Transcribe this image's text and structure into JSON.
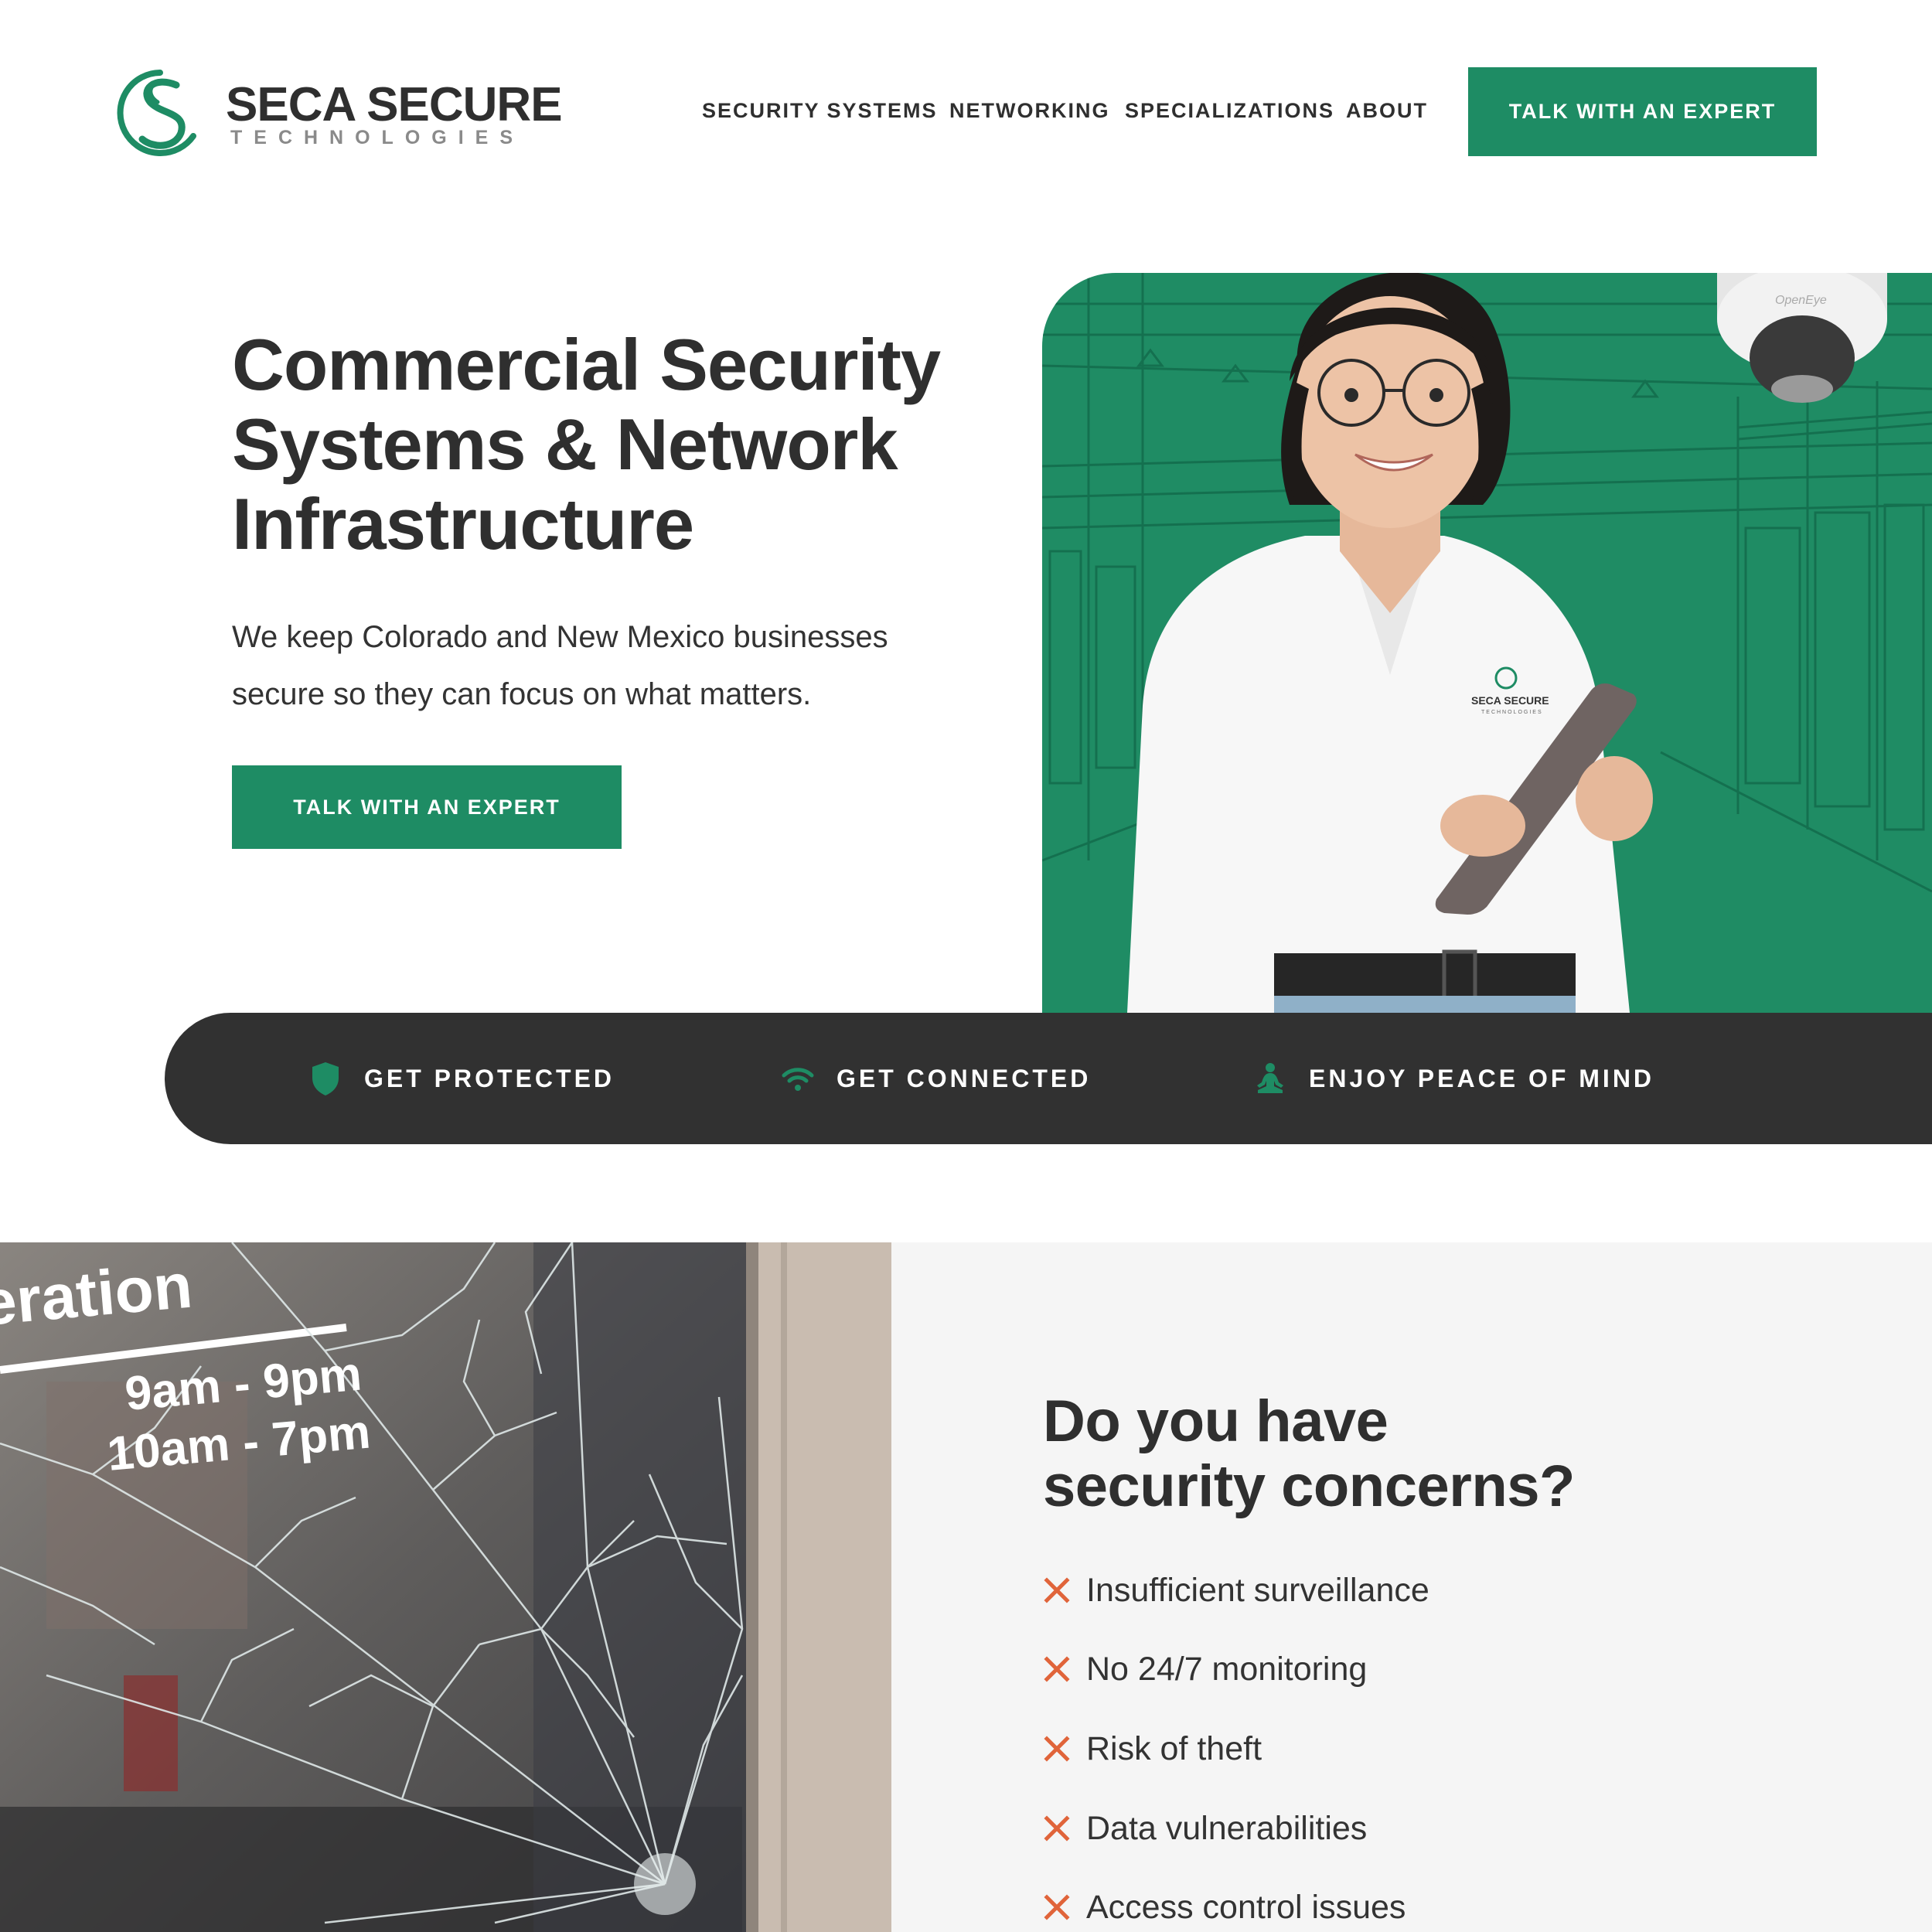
{
  "brand": {
    "name": "SECA SECURE",
    "tagline": "TECHNOLOGIES",
    "accent_color": "#1e8c64",
    "dark_color": "#313131",
    "concern_marker_color": "#e0643a"
  },
  "nav": {
    "items": [
      {
        "label": "SECURITY SYSTEMS"
      },
      {
        "label": "NETWORKING"
      },
      {
        "label": "SPECIALIZATIONS"
      },
      {
        "label": "ABOUT"
      }
    ],
    "cta_label": "TALK WITH AN EXPERT"
  },
  "hero": {
    "title_lines": [
      "Commercial Security",
      "Systems & Network",
      "Infrastructure"
    ],
    "description_lines": [
      "We keep Colorado and New Mexico businesses",
      "secure so they can focus on what matters."
    ],
    "cta_label": "TALK WITH AN EXPERT",
    "shirt_logo_name": "SECA SECURE",
    "shirt_logo_sub": "TECHNOLOGIES",
    "camera_brand": "OpenEye"
  },
  "features": [
    {
      "label": "GET PROTECTED",
      "icon": "shield-icon"
    },
    {
      "label": "GET CONNECTED",
      "icon": "wifi-icon"
    },
    {
      "label": "ENJOY PEACE OF MIND",
      "icon": "meditation-icon"
    }
  ],
  "glass_sign": {
    "word": "eration",
    "hours": [
      "9am - 9pm",
      "10am - 7pm"
    ]
  },
  "concerns": {
    "title_lines": [
      "Do you have",
      "security concerns?"
    ],
    "items": [
      {
        "text": "Insufficient surveillance",
        "icon": "x-icon"
      },
      {
        "text": "No 24/7 monitoring",
        "icon": "x-icon"
      },
      {
        "text": "Risk of theft",
        "icon": "x-icon"
      },
      {
        "text": "Data vulnerabilities",
        "icon": "x-icon"
      },
      {
        "text": "Access control issues",
        "icon": "x-icon"
      }
    ]
  }
}
